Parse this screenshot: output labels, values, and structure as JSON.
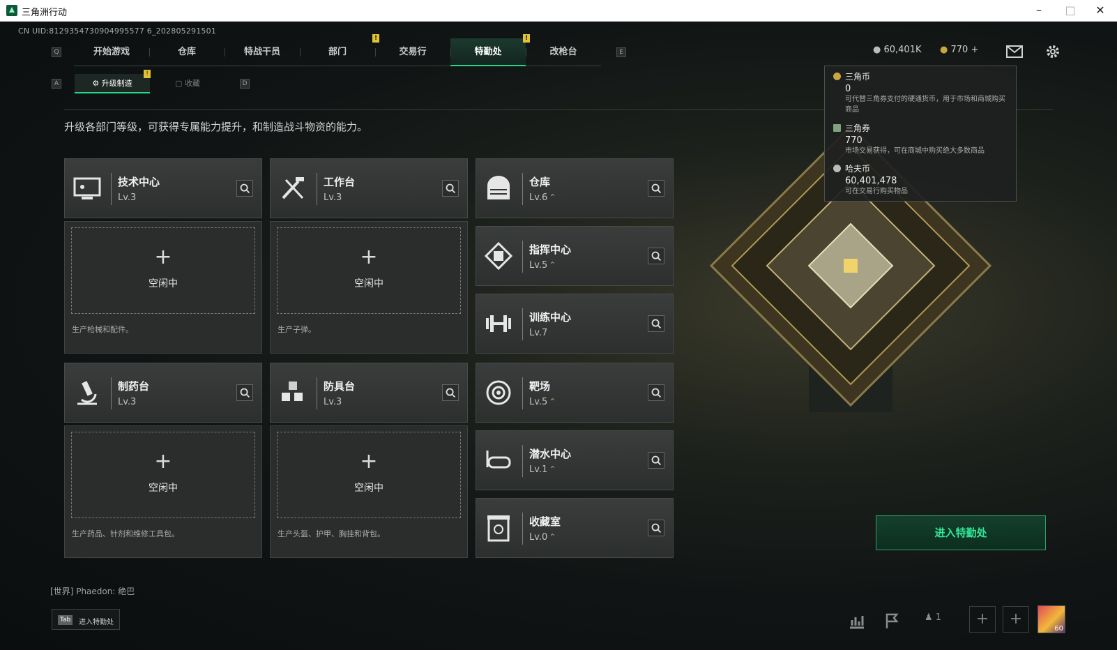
{
  "window": {
    "title": "三角洲行动"
  },
  "uid": "CN UID:8129354730904995577 6_202805291501",
  "nav": {
    "left_key": "Q",
    "right_key": "E",
    "tabs": [
      "开始游戏",
      "仓库",
      "特战干员",
      "部门",
      "交易行",
      "特勤处",
      "改枪台"
    ],
    "active_tab": "特勤处",
    "warn_mark": "!"
  },
  "subnav": {
    "left_key": "A",
    "right_key": "D",
    "tabs": [
      "升级制造",
      "收藏"
    ],
    "active": "升级制造"
  },
  "description": "升级各部门等级，可获得专属能力提升，和制造战斗物资的能力。",
  "production": [
    {
      "name": "技术中心",
      "level": "Lv.3",
      "icon": "computer-icon",
      "slot": {
        "plus": "+",
        "status": "空闲中",
        "hint": "生产枪械和配件。"
      }
    },
    {
      "name": "工作台",
      "level": "Lv.3",
      "icon": "tools-icon",
      "slot": {
        "plus": "+",
        "status": "空闲中",
        "hint": "生产子弹。"
      }
    },
    {
      "name": "制药台",
      "level": "Lv.3",
      "icon": "microscope-icon",
      "slot": {
        "plus": "+",
        "status": "空闲中",
        "hint": "生产药品、针剂和维修工具包。"
      }
    },
    {
      "name": "防具台",
      "level": "Lv.3",
      "icon": "cubes-icon",
      "slot": {
        "plus": "+",
        "status": "空闲中",
        "hint": "生产头盔、护甲、胸挂和背包。"
      }
    }
  ],
  "departments": [
    {
      "name": "仓库",
      "level": "Lv.6",
      "icon": "warehouse-icon"
    },
    {
      "name": "指挥中心",
      "level": "Lv.5",
      "icon": "command-chip-icon"
    },
    {
      "name": "训练中心",
      "level": "Lv.7",
      "icon": "dumbbell-icon"
    },
    {
      "name": "靶场",
      "level": "Lv.5",
      "icon": "target-icon"
    },
    {
      "name": "潜水中心",
      "level": "Lv.1",
      "icon": "diving-mask-icon"
    },
    {
      "name": "收藏室",
      "level": "Lv.0",
      "icon": "collection-icon"
    }
  ],
  "upgrade_mark": "⌃",
  "currency_bar": {
    "hafu": "60,401K",
    "triangle_ticket": "770",
    "plus": "+"
  },
  "tooltip": [
    {
      "name": "三角币",
      "value": "0",
      "desc": "可代替三角券支付的硬通货币，用于市场和商城购买商品",
      "color": "#c9a640"
    },
    {
      "name": "三角券",
      "value": "770",
      "desc": "市场交易获得，可在商城中购买绝大多数商品",
      "color": "#7fa27f"
    },
    {
      "name": "哈夫币",
      "value": "60,401,478",
      "desc": "可在交易行购买物品",
      "color": "#b8bcbb"
    }
  ],
  "enter_button": "进入特勤处",
  "chat": {
    "channel": "[世界]",
    "user": "Phaedon:",
    "message": "绝巴"
  },
  "tab_hint": {
    "key": "Tab",
    "label": "进入特勤处"
  },
  "bottom": {
    "friends": "1",
    "avatar_level": "60"
  },
  "colors": {
    "accent": "#21d789",
    "warning": "#e3c335"
  }
}
